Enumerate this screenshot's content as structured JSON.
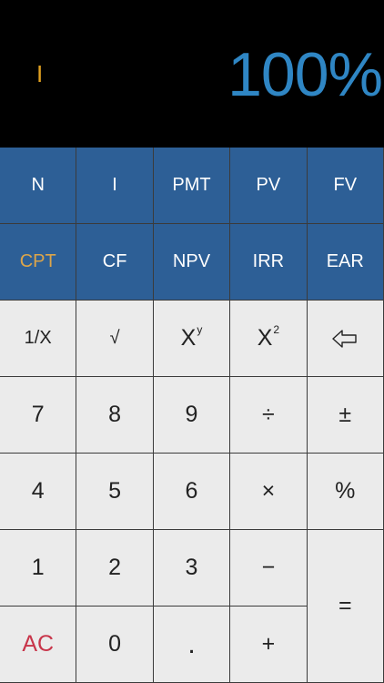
{
  "colors": {
    "battery": "#37e05a",
    "display_text": "#2f86c4",
    "mode_text": "#e0a020",
    "fin_key_bg": "#2d5f96",
    "num_key_bg": "#ebebeb",
    "grid_line": "#3b3b3b",
    "cpt_text": "#dca54a",
    "ac_text": "#c8354a"
  },
  "status": {
    "battery_icon": "battery-icon"
  },
  "display": {
    "mode_indicator": "I",
    "value": "100%"
  },
  "keys": {
    "row1": [
      "N",
      "I",
      "PMT",
      "PV",
      "FV"
    ],
    "row2": [
      "CPT",
      "CF",
      "NPV",
      "IRR",
      "EAR"
    ],
    "row3": {
      "reciprocal": "1/X",
      "sqrt": "√",
      "power_base": "X",
      "power_exp": "y",
      "square_base": "X",
      "square_exp": "2",
      "backspace_icon": "backspace-arrow-icon"
    },
    "row4": [
      "7",
      "8",
      "9",
      "÷",
      "±"
    ],
    "row5": [
      "4",
      "5",
      "6",
      "×",
      "%"
    ],
    "row6": [
      "1",
      "2",
      "3",
      "−"
    ],
    "row7": [
      "AC",
      "0",
      ".",
      "+"
    ],
    "equals": "="
  }
}
